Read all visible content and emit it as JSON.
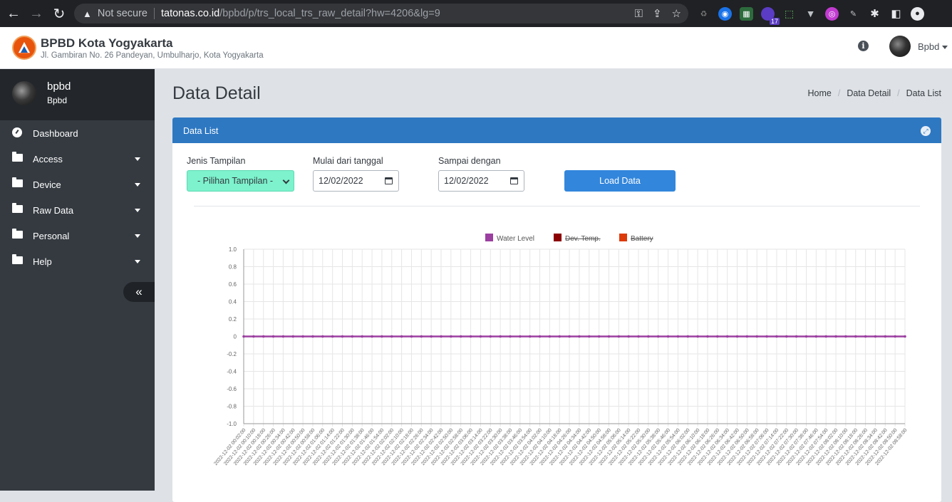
{
  "browser": {
    "nav": {
      "back": "←",
      "forward": "→",
      "reload": "↻"
    },
    "security": "Not secure",
    "url_host": "tatonas.co.id",
    "url_rest": "/bpbd/p/trs_local_trs_raw_detail?hw=4206&lg=9",
    "omni_icons": [
      "key-icon",
      "share-icon",
      "star-icon"
    ],
    "extension_badge": "17"
  },
  "header": {
    "title": "BPBD Kota Yogyakarta",
    "address": "Jl. Gambiran No. 26 Pandeyan, Umbulharjo, Kota Yogyakarta",
    "info_icon": "i",
    "user_label": "Bpbd"
  },
  "sidebar": {
    "username": "bpbd",
    "role": "Bpbd",
    "items": [
      {
        "label": "Dashboard",
        "icon": "gauge-icon",
        "caret": false
      },
      {
        "label": "Access",
        "icon": "folder-icon",
        "caret": true
      },
      {
        "label": "Device",
        "icon": "folder-icon",
        "caret": true
      },
      {
        "label": "Raw Data",
        "icon": "folder-icon",
        "caret": true
      },
      {
        "label": "Personal",
        "icon": "folder-icon",
        "caret": true
      },
      {
        "label": "Help",
        "icon": "folder-icon",
        "caret": true
      }
    ],
    "collapse": "«"
  },
  "page": {
    "title": "Data Detail",
    "breadcrumb": [
      "Home",
      "Data Detail",
      "Data List"
    ]
  },
  "card": {
    "title": "Data List",
    "form": {
      "display_label": "Jenis Tampilan",
      "display_value": "- Pilihan Tampilan -",
      "from_label": "Mulai dari tanggal",
      "from_value": "12/02/2022",
      "to_label": "Sampai dengan",
      "to_value": "12/02/2022",
      "load_button": "Load Data"
    }
  },
  "colors": {
    "water_level": "#9b3fa0",
    "dev_temp": "#8b0000",
    "battery": "#dd3a0a",
    "card_header": "#2e78c2",
    "sidebar": "#343a40"
  },
  "chart_data": {
    "type": "line",
    "legend": [
      {
        "name": "Water Level",
        "color": "#9b3fa0",
        "hidden": false
      },
      {
        "name": "Dev. Temp.",
        "color": "#8b0000",
        "hidden": true
      },
      {
        "name": "Battery",
        "color": "#dd3a0a",
        "hidden": true
      }
    ],
    "ylim": [
      -1.0,
      1.0
    ],
    "yticks": [
      "1.0",
      "0.8",
      "0.6",
      "0.4",
      "0.2",
      "0",
      "-0.2",
      "-0.4",
      "-0.6",
      "-0.8",
      "-1.0"
    ],
    "grid": true,
    "x": [
      "2022-12-02 00:02:00",
      "2022-12-02 00:10:00",
      "2022-12-02 00:18:00",
      "2022-12-02 00:26:00",
      "2022-12-02 00:34:00",
      "2022-12-02 00:42:00",
      "2022-12-02 00:50:00",
      "2022-12-02 00:58:00",
      "2022-12-02 01:06:00",
      "2022-12-02 01:14:00",
      "2022-12-02 01:22:00",
      "2022-12-02 01:30:00",
      "2022-12-02 01:38:00",
      "2022-12-02 01:46:00",
      "2022-12-02 01:54:00",
      "2022-12-02 02:02:00",
      "2022-12-02 02:10:00",
      "2022-12-02 02:18:00",
      "2022-12-02 02:26:00",
      "2022-12-02 02:34:00",
      "2022-12-02 02:42:00",
      "2022-12-02 02:50:00",
      "2022-12-02 02:58:00",
      "2022-12-02 03:06:00",
      "2022-12-02 03:14:00",
      "2022-12-02 03:22:00",
      "2022-12-02 03:30:00",
      "2022-12-02 03:38:00",
      "2022-12-02 03:46:00",
      "2022-12-02 03:54:00",
      "2022-12-02 04:02:00",
      "2022-12-02 04:10:00",
      "2022-12-02 04:18:00",
      "2022-12-02 04:26:00",
      "2022-12-02 04:34:00",
      "2022-12-02 04:42:00",
      "2022-12-02 04:50:00",
      "2022-12-02 04:58:00",
      "2022-12-02 05:06:00",
      "2022-12-02 05:14:00",
      "2022-12-02 05:22:00",
      "2022-12-02 05:30:00",
      "2022-12-02 05:38:00",
      "2022-12-02 05:46:00",
      "2022-12-02 05:54:00",
      "2022-12-02 06:02:00",
      "2022-12-02 06:10:00",
      "2022-12-02 06:18:00",
      "2022-12-02 06:26:00",
      "2022-12-02 06:34:00",
      "2022-12-02 06:42:00",
      "2022-12-02 06:50:00",
      "2022-12-02 06:58:00",
      "2022-12-02 07:06:00",
      "2022-12-02 07:14:00",
      "2022-12-02 07:22:00",
      "2022-12-02 07:30:00",
      "2022-12-02 07:38:00",
      "2022-12-02 07:46:00",
      "2022-12-02 07:54:00",
      "2022-12-02 08:02:00",
      "2022-12-02 08:10:00",
      "2022-12-02 08:18:00",
      "2022-12-02 08:26:00",
      "2022-12-02 08:34:00",
      "2022-12-02 08:42:00",
      "2022-12-02 08:50:00",
      "2022-12-02 08:58:00"
    ],
    "series": [
      {
        "name": "Water Level",
        "values": [
          0,
          0,
          0,
          0,
          0,
          0,
          0,
          0,
          0,
          0,
          0,
          0,
          0,
          0,
          0,
          0,
          0,
          0,
          0,
          0,
          0,
          0,
          0,
          0,
          0,
          0,
          0,
          0,
          0,
          0,
          0,
          0,
          0,
          0,
          0,
          0,
          0,
          0,
          0,
          0,
          0,
          0,
          0,
          0,
          0,
          0,
          0,
          0,
          0,
          0,
          0,
          0,
          0,
          0,
          0,
          0,
          0,
          0,
          0,
          0,
          0,
          0,
          0,
          0,
          0,
          0,
          0,
          0
        ]
      }
    ]
  }
}
